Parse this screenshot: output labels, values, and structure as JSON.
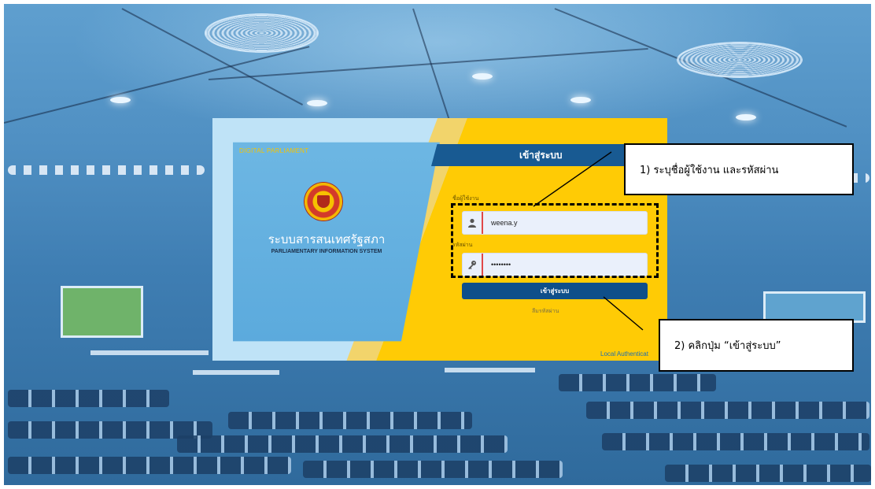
{
  "login_card": {
    "header_title": "เข้าสู่ระบบ",
    "brand_top": "DIGITAL PARLIAMENT",
    "system_name_thai": "ระบบสารสนเทศรัฐสภา",
    "system_name_en": "PARLIAMENTARY INFORMATION SYSTEM",
    "emblem_icon": "parliament-emblem",
    "username_label": "ชื่อผู้ใช้งาน",
    "username_value": "weena.y",
    "username_icon": "user-icon",
    "password_label": "รหัสผ่าน",
    "password_value": "••••••••",
    "password_icon": "key-icon",
    "login_button": "เข้าสู่ระบบ",
    "forgot_password": "ลืมรหัสผ่าน",
    "auth_mode": "Local Authenticat"
  },
  "annotations": {
    "step1": "1) ระบุชื่อผู้ใช้งาน และรหัสผ่าน",
    "step2": "2) คลิกปุ่ม “เข้าสู่ระบบ”"
  },
  "colors": {
    "header_bar": "#185a92",
    "card_yellow": "#ffcb05",
    "left_panel": "#5aa9dc",
    "button": "#0f4f8a",
    "input_accent": "#e04848"
  }
}
